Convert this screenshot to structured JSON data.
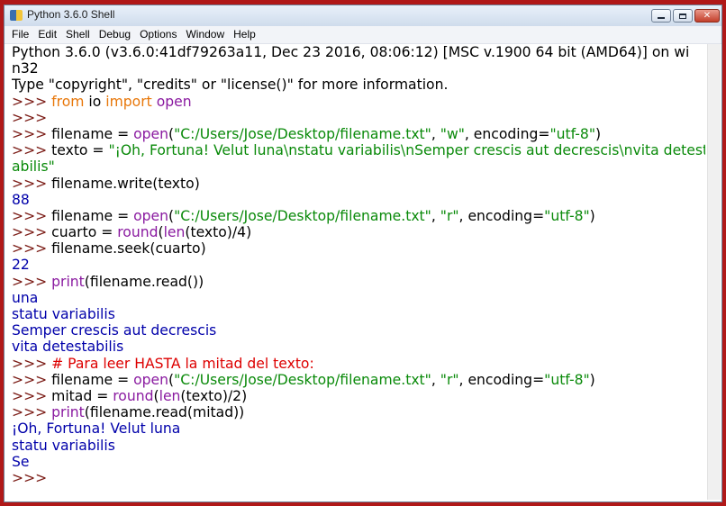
{
  "window": {
    "title": "Python 3.6.0 Shell",
    "controls": {
      "minimize": "minimize",
      "maximize": "maximize",
      "close": "close"
    }
  },
  "menu": {
    "items": [
      "File",
      "Edit",
      "Shell",
      "Debug",
      "Options",
      "Window",
      "Help"
    ]
  },
  "colors": {
    "text": "#000000",
    "prompt": "#7a1a14",
    "keyword": "#e8770a",
    "builtin": "#8a1aa0",
    "string": "#0a8a0a",
    "output": "#0000aa",
    "comment": "#dd0000"
  },
  "shell": {
    "lines": [
      [
        {
          "t": "out_plain",
          "v": "Python 3.6.0 (v3.6.0:41df79263a11, Dec 23 2016, 08:06:12) [MSC v.1900 64 bit (AMD64)] on wi"
        }
      ],
      [
        {
          "t": "out_plain",
          "v": "n32"
        }
      ],
      [
        {
          "t": "out_plain",
          "v": "Type \"copyright\", \"credits\" or \"license()\" for more information."
        }
      ],
      [
        {
          "t": "prompt",
          "v": ">>> "
        },
        {
          "t": "kw",
          "v": "from"
        },
        {
          "t": "plain",
          "v": " io "
        },
        {
          "t": "kw",
          "v": "import"
        },
        {
          "t": "plain",
          "v": " "
        },
        {
          "t": "bi",
          "v": "open"
        }
      ],
      [
        {
          "t": "prompt",
          "v": ">>> "
        }
      ],
      [
        {
          "t": "prompt",
          "v": ">>> "
        },
        {
          "t": "plain",
          "v": "filename = "
        },
        {
          "t": "bi",
          "v": "open"
        },
        {
          "t": "plain",
          "v": "("
        },
        {
          "t": "str",
          "v": "\"C:/Users/Jose/Desktop/filename.txt\""
        },
        {
          "t": "plain",
          "v": ", "
        },
        {
          "t": "str",
          "v": "\"w\""
        },
        {
          "t": "plain",
          "v": ", encoding="
        },
        {
          "t": "str",
          "v": "\"utf-8\""
        },
        {
          "t": "plain",
          "v": ")"
        }
      ],
      [
        {
          "t": "prompt",
          "v": ">>> "
        },
        {
          "t": "plain",
          "v": "texto = "
        },
        {
          "t": "str",
          "v": "\"¡Oh, Fortuna! Velut luna\\nstatu variabilis\\nSemper crescis aut decrescis\\nvita detest"
        }
      ],
      [
        {
          "t": "str",
          "v": "abilis\""
        }
      ],
      [
        {
          "t": "prompt",
          "v": ">>> "
        },
        {
          "t": "plain",
          "v": "filename.write(texto)"
        }
      ],
      [
        {
          "t": "out",
          "v": "88"
        }
      ],
      [
        {
          "t": "prompt",
          "v": ">>> "
        },
        {
          "t": "plain",
          "v": "filename = "
        },
        {
          "t": "bi",
          "v": "open"
        },
        {
          "t": "plain",
          "v": "("
        },
        {
          "t": "str",
          "v": "\"C:/Users/Jose/Desktop/filename.txt\""
        },
        {
          "t": "plain",
          "v": ", "
        },
        {
          "t": "str",
          "v": "\"r\""
        },
        {
          "t": "plain",
          "v": ", encoding="
        },
        {
          "t": "str",
          "v": "\"utf-8\""
        },
        {
          "t": "plain",
          "v": ")"
        }
      ],
      [
        {
          "t": "prompt",
          "v": ">>> "
        },
        {
          "t": "plain",
          "v": "cuarto = "
        },
        {
          "t": "bi",
          "v": "round"
        },
        {
          "t": "plain",
          "v": "("
        },
        {
          "t": "bi",
          "v": "len"
        },
        {
          "t": "plain",
          "v": "(texto)/4)"
        }
      ],
      [
        {
          "t": "prompt",
          "v": ">>> "
        },
        {
          "t": "plain",
          "v": "filename.seek(cuarto)"
        }
      ],
      [
        {
          "t": "out",
          "v": "22"
        }
      ],
      [
        {
          "t": "prompt",
          "v": ">>> "
        },
        {
          "t": "bi",
          "v": "print"
        },
        {
          "t": "plain",
          "v": "(filename.read())"
        }
      ],
      [
        {
          "t": "out",
          "v": "una"
        }
      ],
      [
        {
          "t": "out",
          "v": "statu variabilis"
        }
      ],
      [
        {
          "t": "out",
          "v": "Semper crescis aut decrescis"
        }
      ],
      [
        {
          "t": "out",
          "v": "vita detestabilis"
        }
      ],
      [
        {
          "t": "prompt",
          "v": ">>> "
        },
        {
          "t": "cmt",
          "v": "# Para leer HASTA la mitad del texto:"
        }
      ],
      [
        {
          "t": "prompt",
          "v": ">>> "
        },
        {
          "t": "plain",
          "v": "filename = "
        },
        {
          "t": "bi",
          "v": "open"
        },
        {
          "t": "plain",
          "v": "("
        },
        {
          "t": "str",
          "v": "\"C:/Users/Jose/Desktop/filename.txt\""
        },
        {
          "t": "plain",
          "v": ", "
        },
        {
          "t": "str",
          "v": "\"r\""
        },
        {
          "t": "plain",
          "v": ", encoding="
        },
        {
          "t": "str",
          "v": "\"utf-8\""
        },
        {
          "t": "plain",
          "v": ")"
        }
      ],
      [
        {
          "t": "prompt",
          "v": ">>> "
        },
        {
          "t": "plain",
          "v": "mitad = "
        },
        {
          "t": "bi",
          "v": "round"
        },
        {
          "t": "plain",
          "v": "("
        },
        {
          "t": "bi",
          "v": "len"
        },
        {
          "t": "plain",
          "v": "(texto)/2)"
        }
      ],
      [
        {
          "t": "prompt",
          "v": ">>> "
        },
        {
          "t": "bi",
          "v": "print"
        },
        {
          "t": "plain",
          "v": "(filename.read(mitad))"
        }
      ],
      [
        {
          "t": "out",
          "v": "¡Oh, Fortuna! Velut luna"
        }
      ],
      [
        {
          "t": "out",
          "v": "statu variabilis"
        }
      ],
      [
        {
          "t": "out",
          "v": "Se"
        }
      ],
      [
        {
          "t": "prompt",
          "v": ">>> "
        }
      ]
    ]
  }
}
